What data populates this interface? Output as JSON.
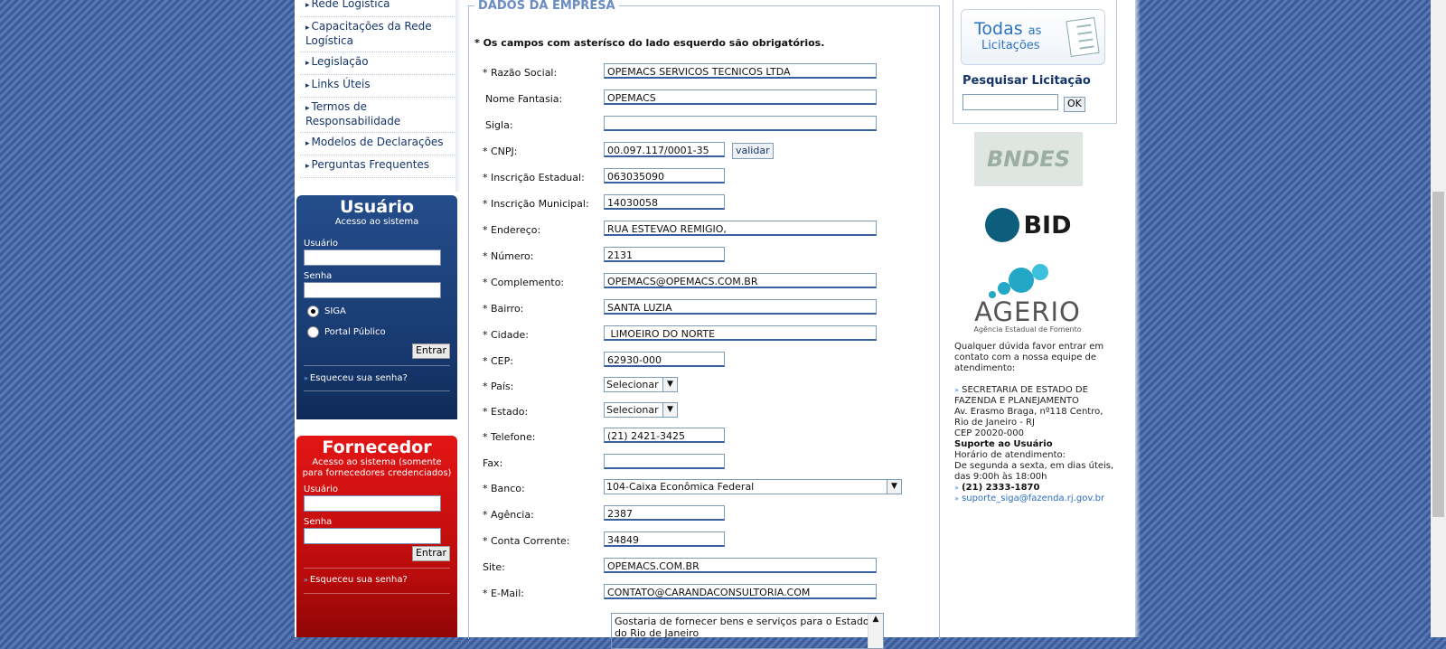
{
  "nav": {
    "items": [
      {
        "label": "Rede Logística"
      },
      {
        "label": "Capacitações da Rede Logística"
      },
      {
        "label": "Legislação"
      },
      {
        "label": "Links Úteis"
      },
      {
        "label": "Termos de Responsabilidade"
      },
      {
        "label": "Modelos de Declarações"
      },
      {
        "label": "Perguntas Frequentes"
      }
    ]
  },
  "user_box": {
    "title": "Usuário",
    "subtitle": "Acesso ao sistema",
    "user_label": "Usuário",
    "password_label": "Senha",
    "radio_siga": "SIGA",
    "radio_portal": "Portal Público",
    "submit": "Entrar",
    "forgot": "Esqueceu sua senha?"
  },
  "supplier_box": {
    "title": "Fornecedor",
    "subtitle": "Acesso ao sistema (somente para fornecedores credenciados)",
    "user_label": "Usuário",
    "password_label": "Senha",
    "submit": "Entrar",
    "forgot": "Esqueceu sua senha?"
  },
  "form": {
    "legend": "DADOS DA EMPRESA",
    "required_note": "* Os campos com asterísco do lado esquerdo são obrigatórios.",
    "fields": {
      "razao_social": {
        "label": "* Razão Social:",
        "value": "OPEMACS SERVICOS TECNICOS LTDA"
      },
      "nome_fantasia": {
        "label": "Nome Fantasia:",
        "value": "OPEMACS"
      },
      "sigla": {
        "label": "Sigla:",
        "value": ""
      },
      "cnpj": {
        "label": "* CNPJ:",
        "value": "00.097.117/0001-35"
      },
      "insc_estadual": {
        "label": "* Inscrição Estadual:",
        "value": "063035090"
      },
      "insc_municipal": {
        "label": "* Inscrição Municipal:",
        "value": "14030058"
      },
      "endereco": {
        "label": "* Endereço:",
        "value": "RUA ESTEVAO REMIGIO,"
      },
      "numero": {
        "label": "* Número:",
        "value": "2131"
      },
      "complemento": {
        "label": "* Complemento:",
        "value": "OPEMACS@OPEMACS.COM.BR"
      },
      "bairro": {
        "label": "* Bairro:",
        "value": "SANTA LUZIA"
      },
      "cidade": {
        "label": "* Cidade:",
        "value": " LIMOEIRO DO NORTE"
      },
      "cep": {
        "label": "* CEP:",
        "value": "62930-000"
      },
      "pais": {
        "label": "* País:",
        "value": "Selecionar"
      },
      "estado": {
        "label": "* Estado:",
        "value": "Selecionar"
      },
      "telefone": {
        "label": "* Telefone:",
        "value": "(21) 2421-3425"
      },
      "fax": {
        "label": "Fax:",
        "value": ""
      },
      "banco": {
        "label": "* Banco:",
        "value": "104-Caixa Econômica Federal"
      },
      "agencia": {
        "label": "* Agência:",
        "value": "2387"
      },
      "conta": {
        "label": "* Conta Corrente:",
        "value": "34849"
      },
      "site": {
        "label": "Site:",
        "value": "OPEMACS.COM.BR"
      },
      "email": {
        "label": "* E-Mail:",
        "value": "CONTATO@CARANDACONSULTORIA.COM"
      }
    },
    "validar_button": "validar",
    "textarea_value": "Gostaria de fornecer bens e serviços para o Estado do Rio de Janeiro"
  },
  "right": {
    "todas_line1": "Todas",
    "todas_as": "as",
    "todas_line2": "Licitações",
    "search_title": "Pesquisar Licitação",
    "search_button": "OK",
    "logo_bndes": "BNDES",
    "logo_bid": "BID",
    "logo_agerio": "AGERIO",
    "logo_agerio_tag": "Agência Estadual de Fomento",
    "contact_intro": "Qualquer dúvida favor entrar em contato com a nossa equipe de atendimento:",
    "org_line1": "SECRETARIA DE ESTADO DE FAZENDA E PLANEJAMENTO",
    "org_line2": "Av. Erasmo Braga, nº118 Centro, Rio de Janeiro - RJ",
    "org_line3": "CEP 20020-000",
    "support_title": "Suporte ao Usuário",
    "hours_title": "Horário de atendimento:",
    "hours": "De segunda a sexta, em dias úteis, das 9:00h às 18:00h",
    "phone": "(21) 2333-1870",
    "email": "suporte_siga@fazenda.rj.gov.br"
  },
  "colors": {
    "user_box": "#17396f",
    "supplier_box": "#b80b0b",
    "legend": "#6a8cc0",
    "link": "#2a6cc2"
  }
}
